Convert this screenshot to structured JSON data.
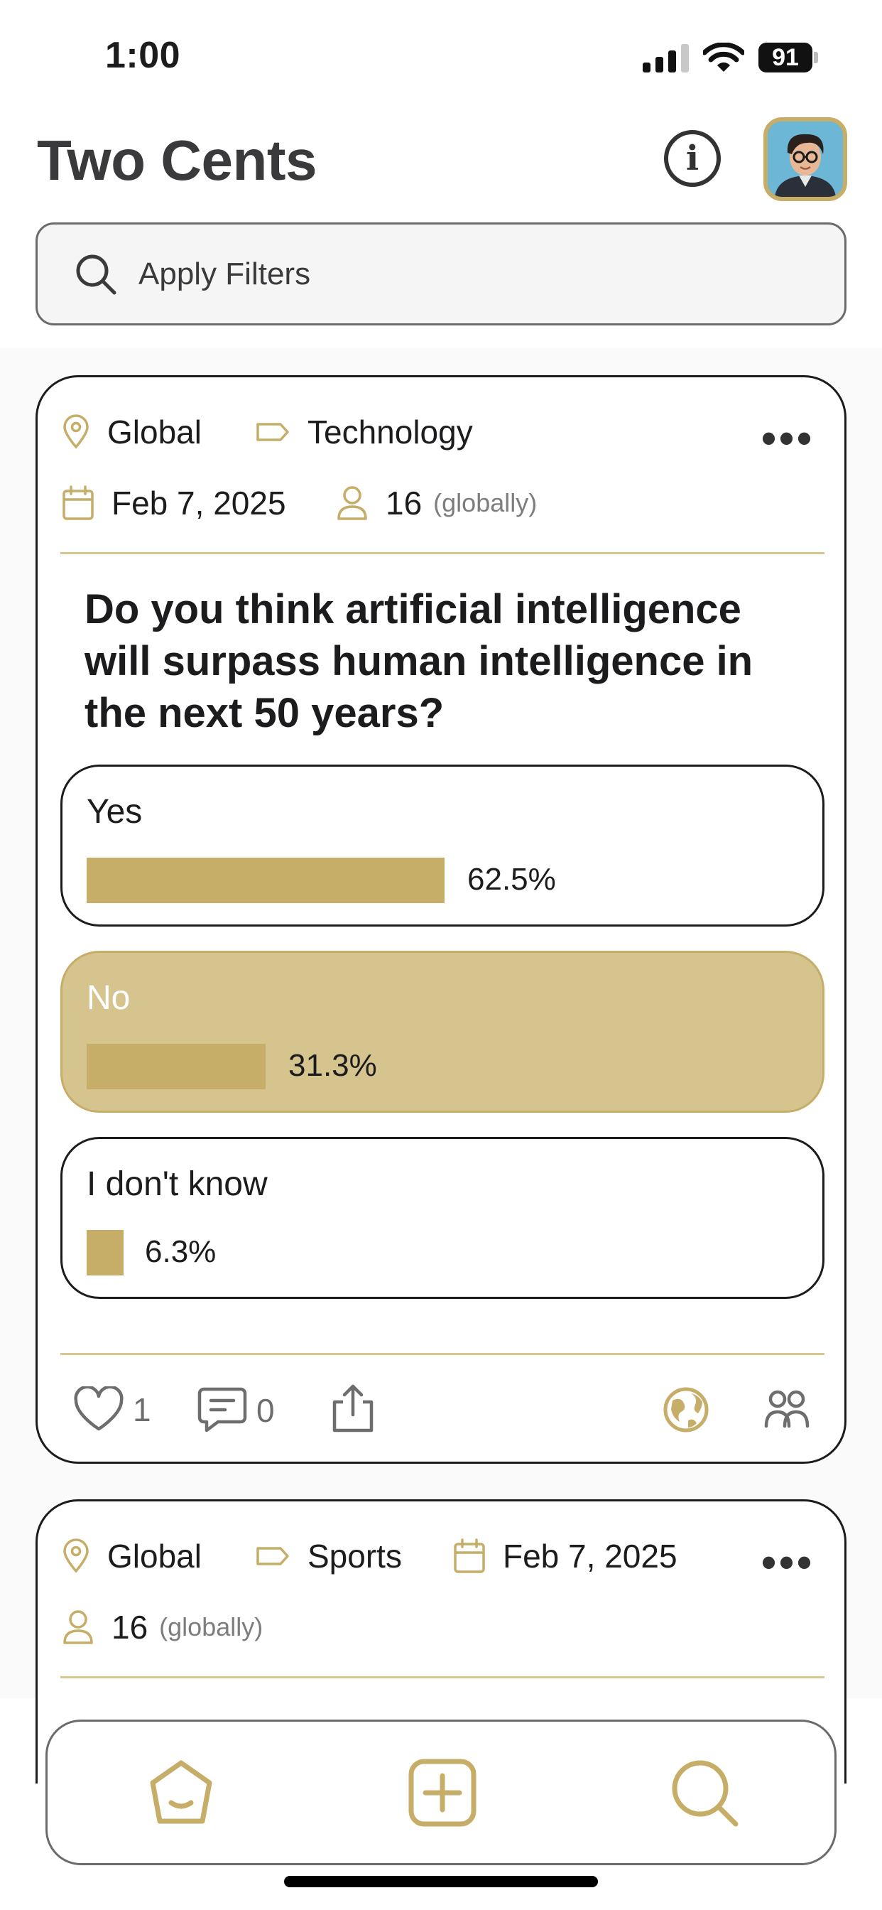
{
  "status_bar": {
    "time": "1:00",
    "battery": "91"
  },
  "header": {
    "title": "Two Cents"
  },
  "search": {
    "placeholder": "Apply Filters"
  },
  "colors": {
    "accent": "#c6ad68",
    "selected_fill": "#d6c48f"
  },
  "posts": [
    {
      "location": "Global",
      "category": "Technology",
      "date": "Feb 7, 2025",
      "participants": "16",
      "participants_scope": "(globally)",
      "question": "Do you think artificial intelligence will surpass human intelligence in the next 50 years?",
      "options": [
        {
          "label": "Yes",
          "percent_text": "62.5%",
          "percent": 62.5,
          "selected": false
        },
        {
          "label": "No",
          "percent_text": "31.3%",
          "percent": 31.3,
          "selected": true
        },
        {
          "label": "I don't know",
          "percent_text": "6.3%",
          "percent": 6.3,
          "selected": false
        }
      ],
      "likes": "1",
      "comments": "0"
    },
    {
      "location": "Global",
      "category": "Sports",
      "date": "Feb 7, 2025",
      "participants": "16",
      "participants_scope": "(globally)"
    }
  ],
  "icons": {
    "location": "location-pin-icon",
    "category": "tag-icon",
    "date": "calendar-icon",
    "participants": "person-icon",
    "more": "more-dots-icon",
    "like": "heart-icon",
    "comment": "comment-icon",
    "share": "share-icon",
    "global": "globe-icon",
    "friends": "people-icon",
    "nav_home": "home-icon",
    "nav_create": "plus-square-icon",
    "nav_search": "search-icon"
  }
}
